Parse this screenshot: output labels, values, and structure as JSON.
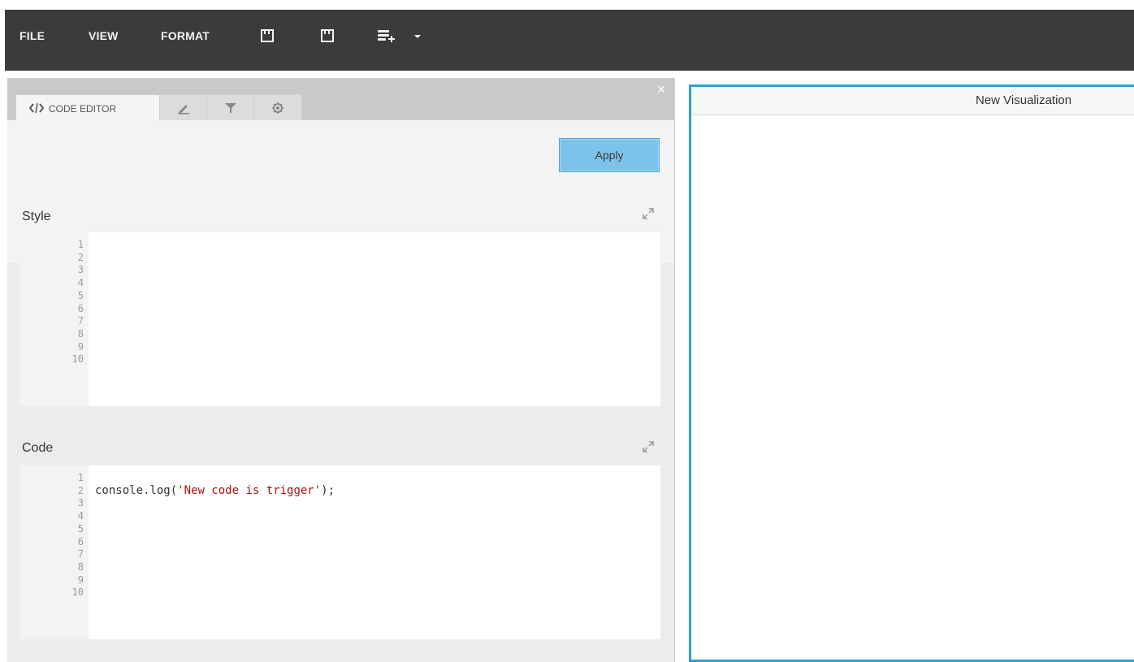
{
  "menu": {
    "file": "FILE",
    "view": "VIEW",
    "format": "FORMAT",
    "icons": [
      "save-icon",
      "save-as-icon",
      "add-data-source-icon",
      "dropdown-caret-icon"
    ]
  },
  "panel": {
    "tabs": {
      "code_editor": "CODE EDITOR",
      "icons": [
        "code-icon",
        "pencil-icon",
        "filter-icon",
        "gear-icon"
      ]
    },
    "apply_label": "Apply",
    "style": {
      "title": "Style",
      "line_numbers": "1\n2\n3\n4\n5\n6\n7\n8\n9\n10",
      "content": ""
    },
    "code": {
      "title": "Code",
      "line_numbers": "1\n2\n3\n4\n5\n6\n7\n8\n9\n10",
      "line2_prefix": "console.log(",
      "line2_string": "'New code is trigger'",
      "line2_suffix": ");"
    }
  },
  "visualization": {
    "title": "New Visualization"
  },
  "colors": {
    "menubar": "#3b3b3b",
    "apply_button": "#7cc3ea",
    "viz_border": "#2aa3d0",
    "string_literal": "#aa1111"
  }
}
